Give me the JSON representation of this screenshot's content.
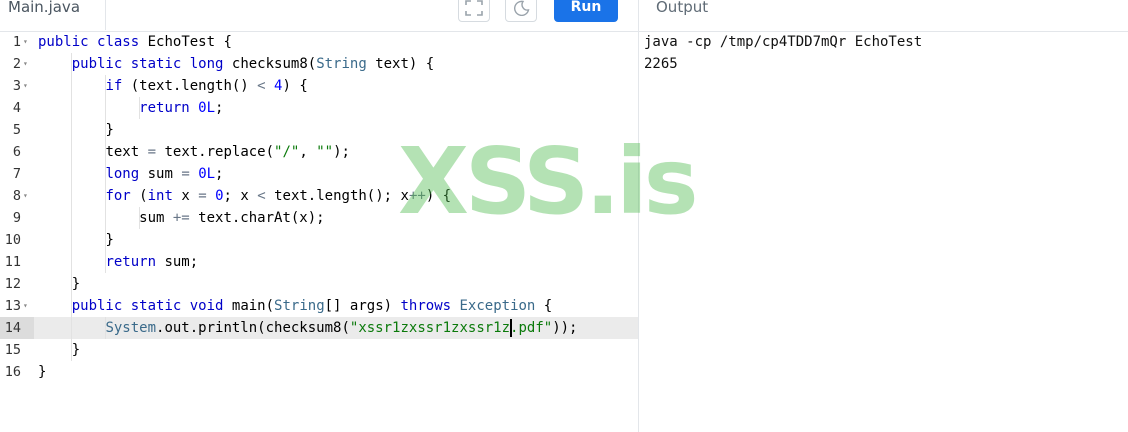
{
  "tabs": {
    "file": "Main.java",
    "output": "Output"
  },
  "toolbar": {
    "fullscreen_icon": "fullscreen-icon",
    "theme_icon": "moon-icon",
    "run_label": "Run",
    "accent": "#1a73e8"
  },
  "editor": {
    "active_line": 14,
    "lines": [
      {
        "n": "1",
        "fold": true
      },
      {
        "n": "2",
        "fold": true
      },
      {
        "n": "3",
        "fold": true
      },
      {
        "n": "4",
        "fold": false
      },
      {
        "n": "5",
        "fold": false
      },
      {
        "n": "6",
        "fold": false
      },
      {
        "n": "7",
        "fold": false
      },
      {
        "n": "8",
        "fold": true
      },
      {
        "n": "9",
        "fold": false
      },
      {
        "n": "10",
        "fold": false
      },
      {
        "n": "11",
        "fold": false
      },
      {
        "n": "12",
        "fold": false
      },
      {
        "n": "13",
        "fold": true
      },
      {
        "n": "14",
        "fold": false
      },
      {
        "n": "15",
        "fold": false
      },
      {
        "n": "16",
        "fold": false
      }
    ],
    "code": [
      {
        "indent": "",
        "tokens": [
          {
            "t": "public",
            "c": "kw"
          },
          {
            "t": " "
          },
          {
            "t": "class",
            "c": "kw"
          },
          {
            "t": " EchoTest {"
          }
        ]
      },
      {
        "indent": "    ",
        "tokens": [
          {
            "t": "public",
            "c": "kw"
          },
          {
            "t": " "
          },
          {
            "t": "static",
            "c": "kw"
          },
          {
            "t": " "
          },
          {
            "t": "long",
            "c": "kw"
          },
          {
            "t": " checksum8("
          },
          {
            "t": "String",
            "c": "ty"
          },
          {
            "t": " text) {"
          }
        ]
      },
      {
        "indent": "        ",
        "tokens": [
          {
            "t": "if",
            "c": "kw"
          },
          {
            "t": " (text.length() "
          },
          {
            "t": "<",
            "c": "op"
          },
          {
            "t": " "
          },
          {
            "t": "4",
            "c": "num"
          },
          {
            "t": ") {"
          }
        ]
      },
      {
        "indent": "            ",
        "tokens": [
          {
            "t": "return",
            "c": "kw"
          },
          {
            "t": " "
          },
          {
            "t": "0L",
            "c": "num"
          },
          {
            "t": ";"
          }
        ]
      },
      {
        "indent": "        ",
        "tokens": [
          {
            "t": "}"
          }
        ]
      },
      {
        "indent": "        ",
        "tokens": [
          {
            "t": "text "
          },
          {
            "t": "=",
            "c": "op"
          },
          {
            "t": " text.replace("
          },
          {
            "t": "\"/\"",
            "c": "str"
          },
          {
            "t": ", "
          },
          {
            "t": "\"\"",
            "c": "str"
          },
          {
            "t": ");"
          }
        ]
      },
      {
        "indent": "        ",
        "tokens": [
          {
            "t": "long",
            "c": "kw"
          },
          {
            "t": " sum "
          },
          {
            "t": "=",
            "c": "op"
          },
          {
            "t": " "
          },
          {
            "t": "0L",
            "c": "num"
          },
          {
            "t": ";"
          }
        ]
      },
      {
        "indent": "        ",
        "tokens": [
          {
            "t": "for",
            "c": "kw"
          },
          {
            "t": " ("
          },
          {
            "t": "int",
            "c": "kw"
          },
          {
            "t": " x "
          },
          {
            "t": "=",
            "c": "op"
          },
          {
            "t": " "
          },
          {
            "t": "0",
            "c": "num"
          },
          {
            "t": "; x "
          },
          {
            "t": "<",
            "c": "op"
          },
          {
            "t": " text.length(); x"
          },
          {
            "t": "++",
            "c": "op"
          },
          {
            "t": ") {"
          }
        ]
      },
      {
        "indent": "            ",
        "tokens": [
          {
            "t": "sum "
          },
          {
            "t": "+=",
            "c": "op"
          },
          {
            "t": " text.charAt(x);"
          }
        ]
      },
      {
        "indent": "        ",
        "tokens": [
          {
            "t": "}"
          }
        ]
      },
      {
        "indent": "        ",
        "tokens": [
          {
            "t": "return",
            "c": "kw"
          },
          {
            "t": " sum;"
          }
        ]
      },
      {
        "indent": "    ",
        "tokens": [
          {
            "t": "}"
          }
        ]
      },
      {
        "indent": "    ",
        "tokens": [
          {
            "t": "public",
            "c": "kw"
          },
          {
            "t": " "
          },
          {
            "t": "static",
            "c": "kw"
          },
          {
            "t": " "
          },
          {
            "t": "void",
            "c": "kw"
          },
          {
            "t": " main("
          },
          {
            "t": "String",
            "c": "ty"
          },
          {
            "t": "[] args) "
          },
          {
            "t": "throws",
            "c": "kw"
          },
          {
            "t": " "
          },
          {
            "t": "Exception",
            "c": "ty"
          },
          {
            "t": " {"
          }
        ]
      },
      {
        "indent": "        ",
        "tokens": [
          {
            "t": "System",
            "c": "ty"
          },
          {
            "t": ".out.println(checksum8("
          },
          {
            "t": "\"xssr1zxssr1zxssr1z.pdf\"",
            "c": "str"
          },
          {
            "t": "));"
          }
        ]
      },
      {
        "indent": "    ",
        "tokens": [
          {
            "t": "}"
          }
        ]
      },
      {
        "indent": "",
        "tokens": [
          {
            "t": "}"
          }
        ]
      }
    ]
  },
  "output": {
    "command": "java -cp /tmp/cp4TDD7mQr EchoTest",
    "result": "2265"
  },
  "watermark": "XSS.is"
}
